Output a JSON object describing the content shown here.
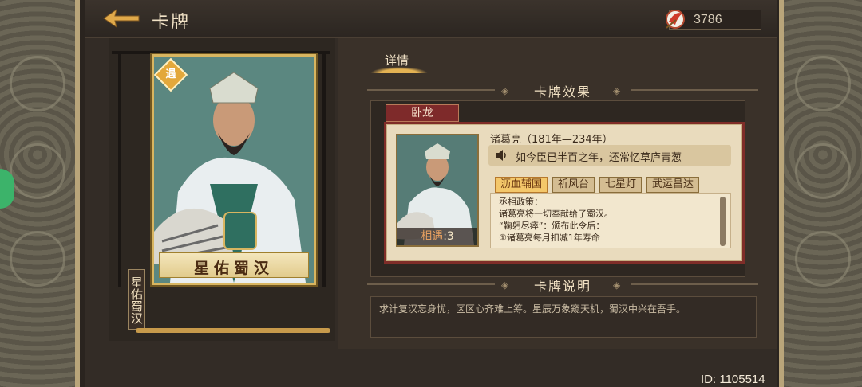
{
  "header": {
    "title": "卡牌",
    "currency_value": "3786"
  },
  "card": {
    "badge": "遇",
    "name": "星佑蜀汉",
    "side_label": "星佑蜀汉"
  },
  "tabs": [
    {
      "label": "详情"
    }
  ],
  "effect": {
    "section_title": "卡牌效果",
    "tab_label": "卧龙",
    "hero_line": "诸葛亮（181年—234年）",
    "quote": "如今臣已半百之年，还常忆草庐青葱",
    "portrait_caption_label": "相遇",
    "portrait_caption_value": ":3",
    "skills": [
      "沥血辅国",
      "祈风台",
      "七星灯",
      "武运昌达"
    ],
    "active_skill_index": 0,
    "desc_lines": [
      "丞相政策：",
      "诸葛亮将一切奉献给了蜀汉。",
      "“鞠躬尽瘁”：颁布此令后：",
      "①诸葛亮每月扣减1年寿命"
    ]
  },
  "explain": {
    "section_title": "卡牌说明",
    "text": "求计复汉忘身忧，区区心齐难上筹。星辰万象窥天机，蜀汉中兴在吾手。"
  },
  "footer": {
    "id_text": "ID: 1105514"
  },
  "colors": {
    "accent_gold": "#e3b253",
    "effect_red": "#7f2d28",
    "active_skill": "#f4c76a"
  },
  "icons": [
    "back-arrow-icon",
    "feather-currency-icon",
    "speaker-icon"
  ]
}
